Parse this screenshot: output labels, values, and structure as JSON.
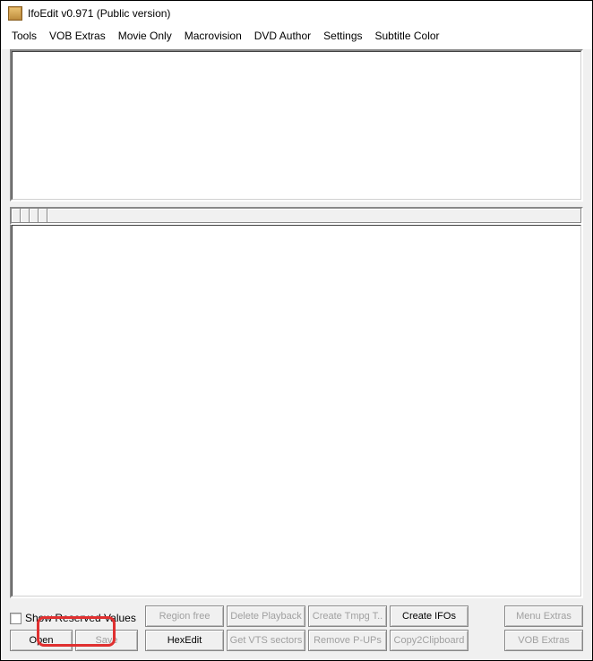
{
  "titlebar": {
    "title": "IfoEdit v0.971 (Public version)"
  },
  "menubar": {
    "items": [
      "Tools",
      "VOB Extras",
      "Movie Only",
      "Macrovision",
      "DVD Author",
      "Settings",
      "Subtitle Color"
    ]
  },
  "bottom": {
    "checkbox_label": "Show Reserved Values",
    "buttons": {
      "open": "Open",
      "save": "Save",
      "region_free": "Region free",
      "hexedit": "HexEdit",
      "delete_playback": "Delete Playback",
      "get_vts": "Get VTS sectors",
      "create_tmpg": "Create Tmpg T..",
      "remove_pups": "Remove P-UPs",
      "create_ifos": "Create IFOs",
      "copy2clip": "Copy2Clipboard",
      "menu_extras": "Menu Extras",
      "vob_extras": "VOB Extras"
    }
  }
}
